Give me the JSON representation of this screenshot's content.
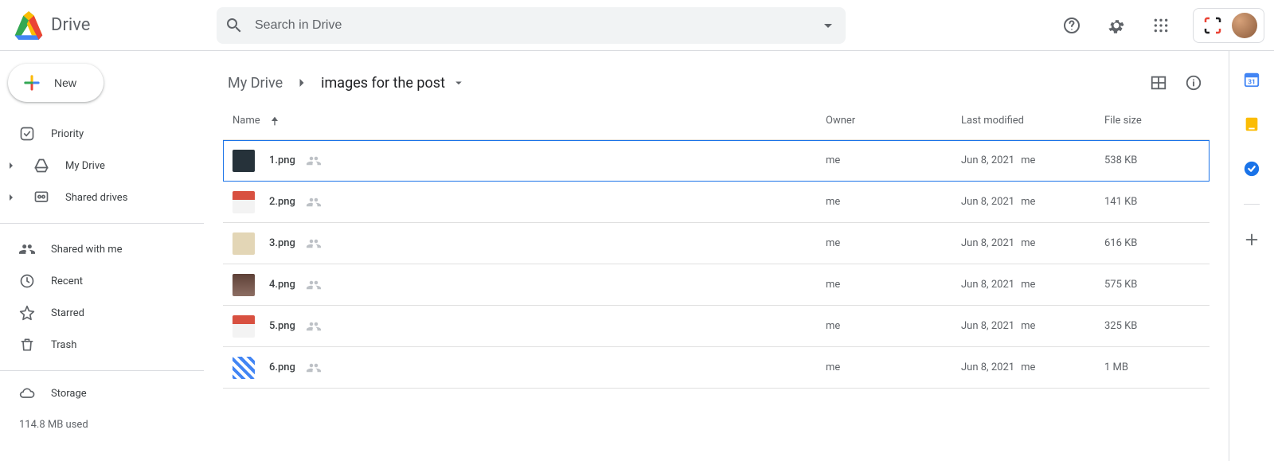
{
  "app": {
    "name": "Drive"
  },
  "search": {
    "placeholder": "Search in Drive"
  },
  "sidebar": {
    "new_label": "New",
    "items": [
      {
        "label": "Priority"
      },
      {
        "label": "My Drive"
      },
      {
        "label": "Shared drives"
      },
      {
        "label": "Shared with me"
      },
      {
        "label": "Recent"
      },
      {
        "label": "Starred"
      },
      {
        "label": "Trash"
      },
      {
        "label": "Storage"
      }
    ],
    "storage_used": "114.8 MB used"
  },
  "breadcrumbs": {
    "root": "My Drive",
    "current": "images for the post"
  },
  "columns": {
    "name": "Name",
    "owner": "Owner",
    "modified": "Last modified",
    "size": "File size"
  },
  "files": [
    {
      "name": "1.png",
      "owner": "me",
      "modified_date": "Jun 8, 2021",
      "modified_by": "me",
      "size": "538 KB",
      "thumb": "dark",
      "selected": true
    },
    {
      "name": "2.png",
      "owner": "me",
      "modified_date": "Jun 8, 2021",
      "modified_by": "me",
      "size": "141 KB",
      "thumb": "red",
      "selected": false
    },
    {
      "name": "3.png",
      "owner": "me",
      "modified_date": "Jun 8, 2021",
      "modified_by": "me",
      "size": "616 KB",
      "thumb": "beige",
      "selected": false
    },
    {
      "name": "4.png",
      "owner": "me",
      "modified_date": "Jun 8, 2021",
      "modified_by": "me",
      "size": "575 KB",
      "thumb": "photo",
      "selected": false
    },
    {
      "name": "5.png",
      "owner": "me",
      "modified_date": "Jun 8, 2021",
      "modified_by": "me",
      "size": "325 KB",
      "thumb": "red",
      "selected": false
    },
    {
      "name": "6.png",
      "owner": "me",
      "modified_date": "Jun 8, 2021",
      "modified_by": "me",
      "size": "1 MB",
      "thumb": "mix",
      "selected": false
    }
  ],
  "rail_apps": [
    "calendar",
    "keep",
    "tasks"
  ]
}
